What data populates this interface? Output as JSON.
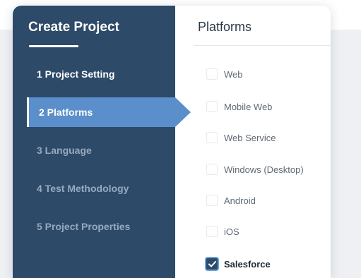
{
  "sidebar": {
    "title": "Create Project",
    "steps": [
      {
        "label": "1 Project Setting",
        "state": "done"
      },
      {
        "label": "2 Platforms",
        "state": "active"
      },
      {
        "label": "3 Language",
        "state": "pending"
      },
      {
        "label": "4 Test Methodology",
        "state": "pending"
      },
      {
        "label": "5 Project Properties",
        "state": "pending"
      }
    ]
  },
  "content": {
    "title": "Platforms",
    "options": [
      {
        "label": "Web",
        "checked": false
      },
      {
        "label": "Mobile Web",
        "checked": false
      },
      {
        "label": "Web Service",
        "checked": false
      },
      {
        "label": "Windows (Desktop)",
        "checked": false
      },
      {
        "label": "Android",
        "checked": false
      },
      {
        "label": "iOS",
        "checked": false
      },
      {
        "label": "Salesforce",
        "checked": true
      }
    ]
  },
  "colors": {
    "sidebar_bg": "#2e4a69",
    "active_step": "#5b8fcb",
    "checked_box": "#2e4a69"
  },
  "icons": {
    "checkmark": "check-icon",
    "active_indicator": "arrow-pointer-icon"
  }
}
